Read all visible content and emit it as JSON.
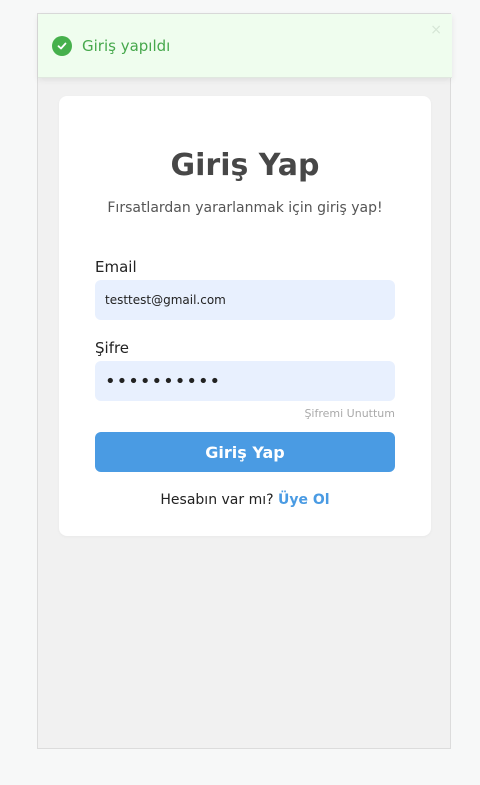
{
  "toast": {
    "message": "Giriş yapıldı",
    "close": "×",
    "icon": "check-circle-icon",
    "color": "#46b04c"
  },
  "login": {
    "title": "Giriş Yap",
    "subtitle": "Fırsatlardan yararlanmak için giriş yap!",
    "email_label": "Email",
    "email_value": "testtest@gmail.com",
    "password_label": "Şifre",
    "password_value": "••••••••••",
    "forgot_password": "Şifremi Unuttum",
    "submit_label": "Giriş Yap",
    "signup_prompt": "Hesabın var mı?",
    "signup_link": "Üye Ol",
    "accent_color": "#4a9be3"
  }
}
